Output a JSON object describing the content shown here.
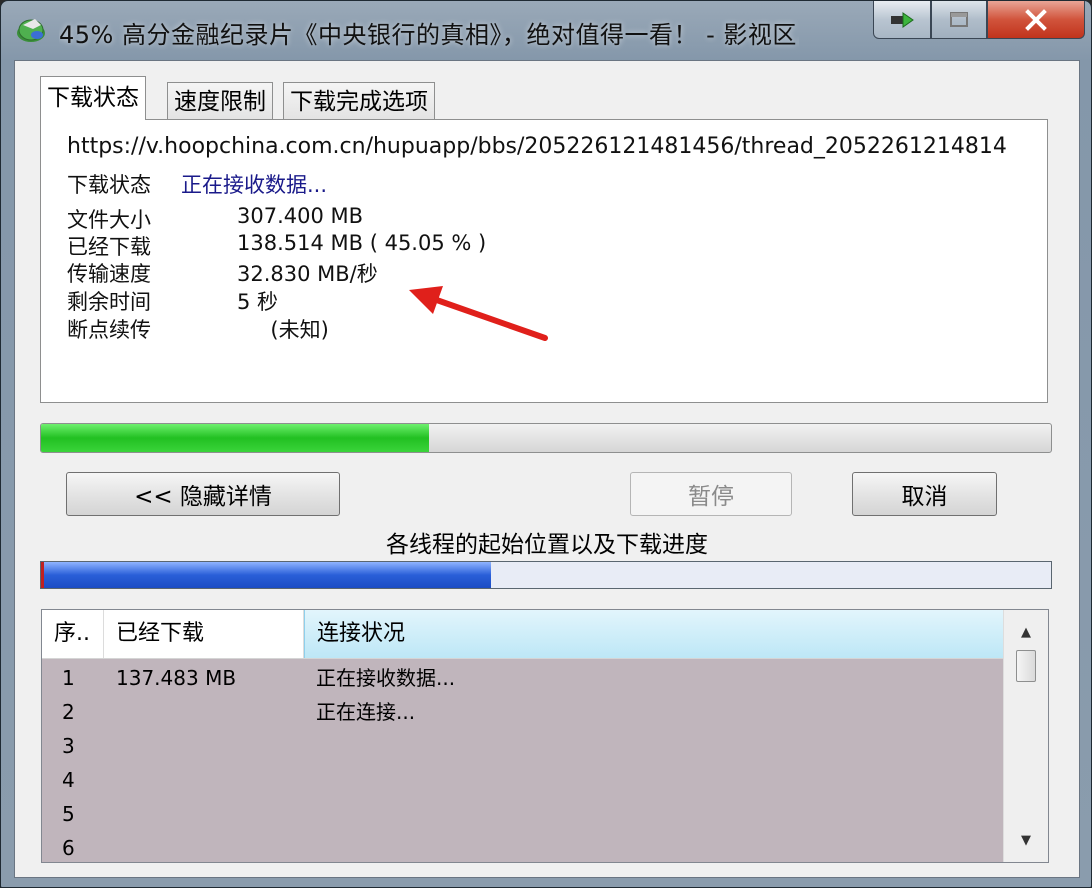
{
  "window": {
    "title": "45% 高分金融纪录片《中央银行的真相》，绝对值得一看！ - 影视区..",
    "icons": {
      "app": "globe-download-icon",
      "minimize": "minimize-icon",
      "maximize": "maximize-icon",
      "close": "close-icon"
    }
  },
  "tabs": [
    {
      "label": "下载状态",
      "active": true
    },
    {
      "label": "速度限制",
      "active": false
    },
    {
      "label": "下载完成选项",
      "active": false
    }
  ],
  "status": {
    "url": "https://v.hoopchina.com.cn/hupuapp/bbs/205226121481456/thread_2052261214814",
    "state_label": "下载状态",
    "state_value": "正在接收数据...",
    "rows": [
      {
        "label": "文件大小",
        "value": "307.400  MB"
      },
      {
        "label": "已经下载",
        "value": "138.514  MB ( 45.05 % )"
      },
      {
        "label": "传输速度",
        "value": "32.830  MB/秒"
      },
      {
        "label": "剩余时间",
        "value": "5 秒"
      },
      {
        "label": "断点续传",
        "value": "     (未知)"
      }
    ]
  },
  "progress": {
    "overall_fraction": 0.3845,
    "threads_fraction": 0.446
  },
  "buttons": {
    "hide_details": "<< 隐藏详情",
    "pause": "暂停",
    "cancel": "取消"
  },
  "threads_caption": "各线程的起始位置以及下载进度",
  "list": {
    "headers": [
      "序..",
      "已经下载",
      "连接状况"
    ],
    "rows": [
      {
        "index": "1",
        "downloaded": "137.483 MB",
        "status": "正在接收数据..."
      },
      {
        "index": "2",
        "downloaded": "",
        "status": "正在连接..."
      },
      {
        "index": "3",
        "downloaded": "",
        "status": ""
      },
      {
        "index": "4",
        "downloaded": "",
        "status": ""
      },
      {
        "index": "5",
        "downloaded": "",
        "status": ""
      },
      {
        "index": "6",
        "downloaded": "",
        "status": ""
      }
    ]
  },
  "colors": {
    "overall_progress": "#22c022",
    "thread_progress": "#2a5fd8",
    "annotation_arrow": "#e0201b",
    "list_background": "#c0b5bc"
  }
}
